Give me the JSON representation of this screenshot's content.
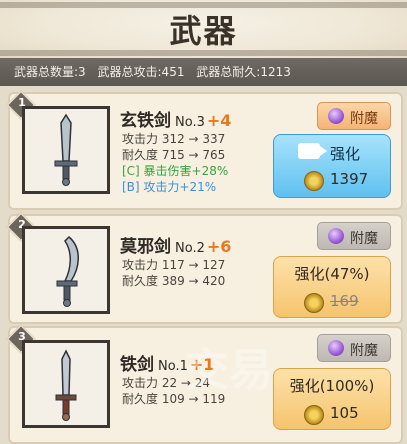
{
  "title": "武器",
  "stats": {
    "count": "武器总数量:3",
    "attack": "武器总攻击:451",
    "durability": "武器总耐久:1213"
  },
  "weapons": [
    {
      "index": "1",
      "name": "玄铁剑",
      "number": "No.3",
      "level": "+4",
      "attack": "攻击力 312 → 337",
      "durability": "耐久度 715 → 765",
      "bonus_crit": "[C] 暴击伤害+28%",
      "bonus_atk": "[B] 攻击力+21%",
      "enchant_label": "附魔",
      "upgrade_label": "强化",
      "upgrade_cost": "1397"
    },
    {
      "index": "2",
      "name": "莫邪剑",
      "number": "No.2",
      "level": "+6",
      "attack": "攻击力 117 → 127",
      "durability": "耐久度 389 → 420",
      "enchant_label": "附魔",
      "upgrade_label": "强化(47%)",
      "upgrade_cost": "169"
    },
    {
      "index": "3",
      "name": "铁剑",
      "number": "No.1",
      "level": "+1",
      "attack": "攻击力 22 → 24",
      "durability": "耐久度 109 → 119",
      "enchant_label": "附魔",
      "upgrade_label": "强化(100%)",
      "upgrade_cost": "105"
    }
  ],
  "watermark": "交易",
  "colors": {
    "level": "#e57a20",
    "crit_bonus": "#3aa13f",
    "atk_bonus": "#3a8fd8",
    "upgrade_ready": "#5fc0f0",
    "upgrade_progress": "#f5c46e"
  }
}
